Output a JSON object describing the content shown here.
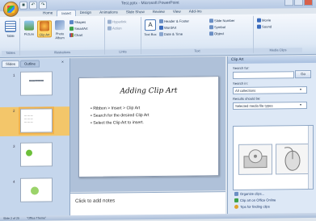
{
  "title_bar": {
    "title": "Test.pptx - Microsoft PowerPoint",
    "qat_icons": [
      "save-icon",
      "undo-icon",
      "redo-icon"
    ]
  },
  "tabs": [
    "Home",
    "Insert",
    "Design",
    "Animations",
    "Slide Show",
    "Review",
    "View",
    "Add-Ins"
  ],
  "active_tab": "Insert",
  "ribbon": {
    "tables": {
      "label": "Tables",
      "button": "Table"
    },
    "illustrations": {
      "label": "Illustrations",
      "picture": "Picture",
      "clip_art": "Clip Art",
      "photo_album": "Photo Album",
      "shapes": "Shapes",
      "smartart": "SmartArt",
      "chart": "Chart"
    },
    "links": {
      "label": "Links",
      "hyperlink": "Hyperlink",
      "action": "Action"
    },
    "text": {
      "label": "Text",
      "text_box": "Text Box",
      "header_footer": "Header & Footer",
      "wordart": "WordArt",
      "date_time": "Date & Time",
      "slide_number": "Slide Number",
      "symbol": "Symbol",
      "object": "Object"
    },
    "media": {
      "label": "Media Clips",
      "movie": "Movie",
      "sound": "Sound"
    }
  },
  "left_pane": {
    "tabs": [
      "Slides",
      "Outline"
    ],
    "close": "×",
    "slides": [
      "1",
      "2",
      "3",
      "4"
    ],
    "selected_slide": 2
  },
  "slide": {
    "title": "Adding Clip Art",
    "bullets": [
      "Ribbon > Insert > Clip Art",
      "Search for the desired Clip Art",
      "Select the Clip Art to insert."
    ]
  },
  "notes": {
    "placeholder": "Click to add notes"
  },
  "task_pane": {
    "title": "Clip Art",
    "search_for_label": "Search for:",
    "search_value": "",
    "go_button": "Go",
    "search_in_label": "Search in:",
    "search_in_value": "All collections",
    "results_label": "Results should be:",
    "results_value": "Selected media file types",
    "links": [
      "Organize clips...",
      "Clip art on Office Online",
      "Tips for finding clips"
    ]
  },
  "status_bar": {
    "slide_info": "Slide 2 of 25",
    "theme": "\"Office Theme\""
  },
  "colors": {
    "ribbon_bg": "#dde8f5",
    "accent_selected": "#f2b24a",
    "titlebar": "#b6c9e4"
  }
}
